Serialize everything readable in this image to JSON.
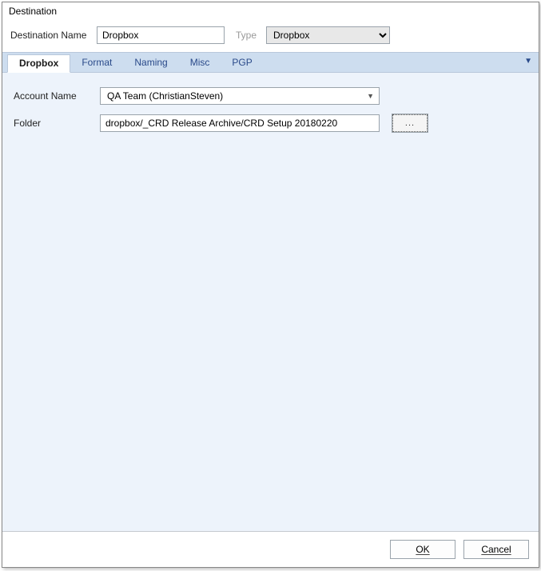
{
  "window": {
    "title": "Destination"
  },
  "header": {
    "destNameLabel": "Destination Name",
    "destNameValue": "Dropbox",
    "typeLabel": "Type",
    "typeValue": "Dropbox"
  },
  "tabs": {
    "items": [
      "Dropbox",
      "Format",
      "Naming",
      "Misc",
      "PGP"
    ],
    "activeIndex": 0
  },
  "form": {
    "accountLabel": "Account Name",
    "accountValue": "QA Team (ChristianSteven)",
    "folderLabel": "Folder",
    "folderValue": "dropbox/_CRD Release Archive/CRD Setup 20180220",
    "browseLabel": "..."
  },
  "footer": {
    "okLabel": "OK",
    "cancelLabel": "Cancel"
  }
}
